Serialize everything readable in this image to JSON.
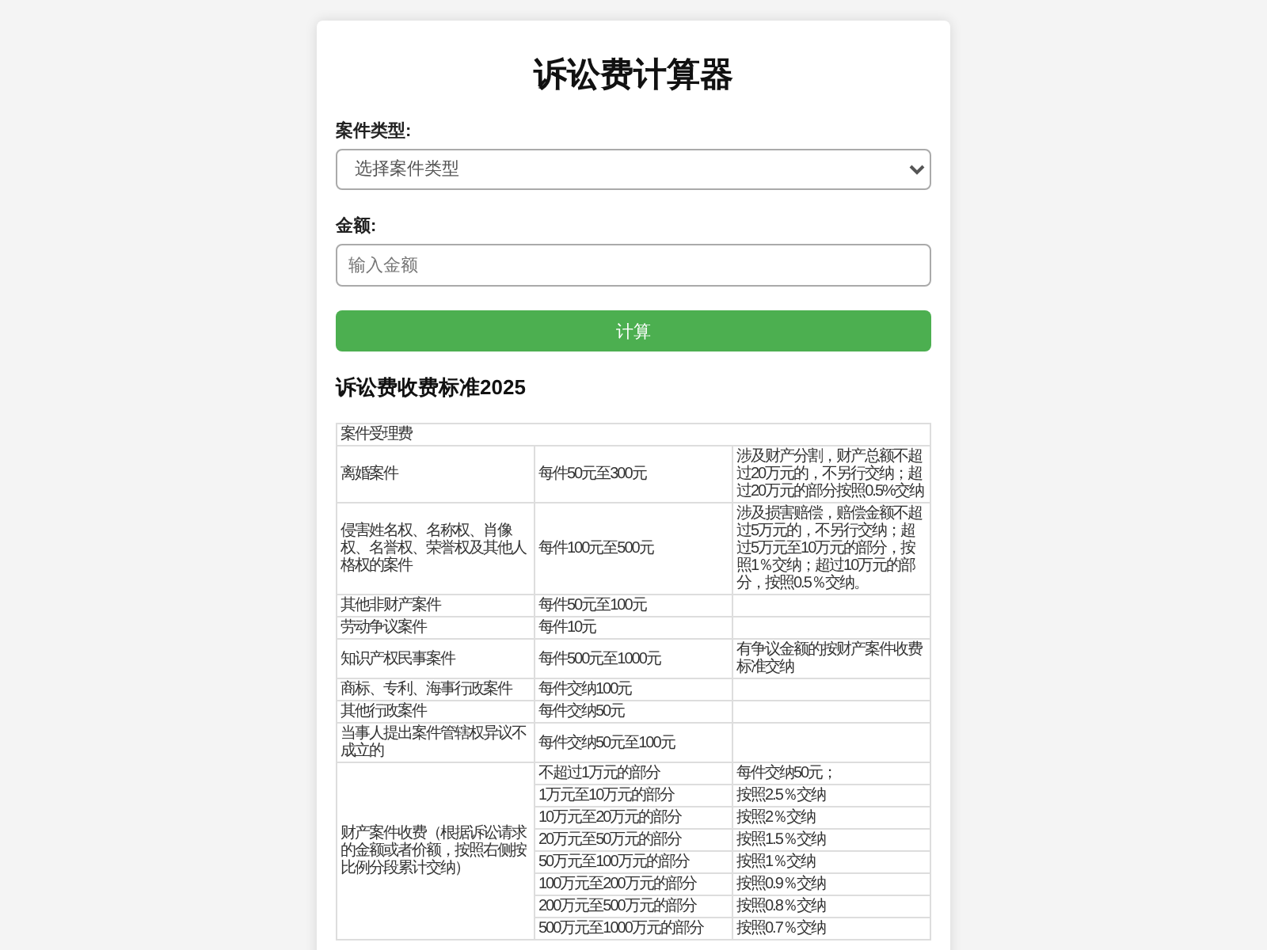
{
  "title": "诉讼费计算器",
  "form": {
    "case_type": {
      "label": "案件类型:",
      "placeholder": "选择案件类型"
    },
    "amount": {
      "label": "金额:",
      "placeholder": "输入金额"
    },
    "submit": "计算"
  },
  "standard": {
    "heading": "诉讼费收费标准2025",
    "table": {
      "section": "案件受理费",
      "rows": [
        {
          "case_type": "离婚案件",
          "fee": "每件50元至300元",
          "note": "涉及财产分割，财产总额不超过20万元的，不另行交纳；超过20万元的部分按照0.5%交纳"
        },
        {
          "case_type": "侵害姓名权、名称权、肖像权、名誉权、荣誉权及其他人格权的案件",
          "fee": "每件100元至500元",
          "note": "涉及损害赔偿，赔偿金额不超过5万元的，不另行交纳；超过5万元至10万元的部分，按照1％交纳；超过10万元的部分，按照0.5％交纳。"
        },
        {
          "case_type": "其他非财产案件",
          "fee": "每件50元至100元"
        },
        {
          "case_type": "劳动争议案件",
          "fee": "每件10元"
        },
        {
          "case_type": "知识产权民事案件",
          "fee": "每件500元至1000元",
          "note": "有争议金额的按财产案件收费标准交纳"
        },
        {
          "case_type": "商标、专利、海事行政案件",
          "fee": "每件交纳100元"
        },
        {
          "case_type": "其他行政案件",
          "fee": "每件交纳50元"
        },
        {
          "case_type": "当事人提出案件管辖权异议不成立的",
          "fee": "每件交纳50元至100元"
        }
      ],
      "property": {
        "label": "财产案件收费（根据诉讼请求的金额或者价额，按照右侧按比例分段累计交纳）",
        "tiers": [
          {
            "range": "不超过1万元的部分",
            "rate": "每件交纳50元；"
          },
          {
            "range": "1万元至10万元的部分",
            "rate": "按照2.5％交纳"
          },
          {
            "range": "10万元至20万元的部分",
            "rate": "按照2％交纳"
          },
          {
            "range": "20万元至50万元的部分",
            "rate": "按照1.5％交纳"
          },
          {
            "range": "50万元至100万元的部分",
            "rate": "按照1％交纳"
          },
          {
            "range": "100万元至200万元的部分",
            "rate": "按照0.9％交纳"
          },
          {
            "range": "200万元至500万元的部分",
            "rate": "按照0.8％交纳"
          },
          {
            "range": "500万元至1000万元的部分",
            "rate": "按照0.7％交纳"
          }
        ]
      }
    }
  }
}
